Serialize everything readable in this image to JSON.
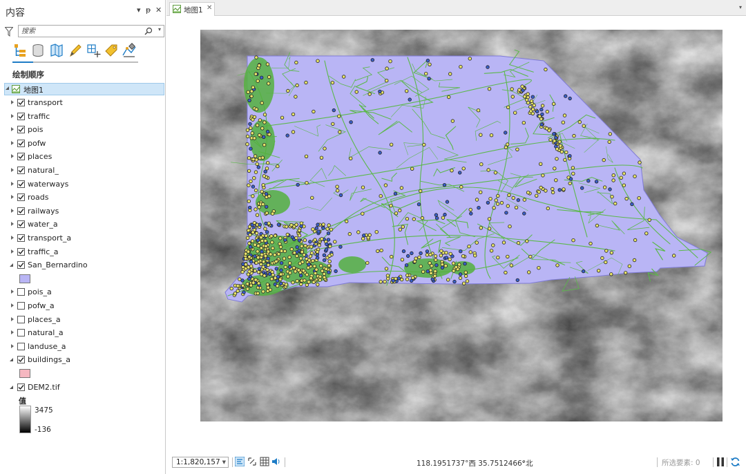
{
  "contents_pane": {
    "title": "内容",
    "pin_label": "▾ 🖈",
    "close_label": "✕",
    "search_placeholder": "搜索",
    "drawing_order_heading": "绘制顺序",
    "map_name": "地图1",
    "layers": [
      {
        "name": "transport",
        "checked": true,
        "expanded": false
      },
      {
        "name": "traffic",
        "checked": true,
        "expanded": false
      },
      {
        "name": "pois",
        "checked": true,
        "expanded": false
      },
      {
        "name": "pofw",
        "checked": true,
        "expanded": false
      },
      {
        "name": "places",
        "checked": true,
        "expanded": false
      },
      {
        "name": "natural_",
        "checked": true,
        "expanded": false
      },
      {
        "name": "waterways",
        "checked": true,
        "expanded": false
      },
      {
        "name": "roads",
        "checked": true,
        "expanded": false
      },
      {
        "name": "railways",
        "checked": true,
        "expanded": false
      },
      {
        "name": "water_a",
        "checked": true,
        "expanded": false
      },
      {
        "name": "transport_a",
        "checked": true,
        "expanded": false
      },
      {
        "name": "traffic_a",
        "checked": true,
        "expanded": false
      },
      {
        "name": "San_Bernardino",
        "checked": true,
        "expanded": true,
        "swatch_color": "#b9b5f5"
      },
      {
        "name": "pois_a",
        "checked": false,
        "expanded": false
      },
      {
        "name": "pofw_a",
        "checked": false,
        "expanded": false
      },
      {
        "name": "places_a",
        "checked": false,
        "expanded": false
      },
      {
        "name": "natural_a",
        "checked": false,
        "expanded": false
      },
      {
        "name": "landuse_a",
        "checked": false,
        "expanded": false
      },
      {
        "name": "buildings_a",
        "checked": true,
        "expanded": true,
        "swatch_color": "#f5b7c0"
      },
      {
        "name": "DEM2.tif",
        "checked": true,
        "expanded": true
      }
    ],
    "dem_legend": {
      "title": "值",
      "high": "3475",
      "low": "-136"
    }
  },
  "map_tab": {
    "label": "地图1",
    "close": "✕"
  },
  "status_bar": {
    "scale": "1:1,820,157",
    "coordinates": "118.1951737°西 35.7512466°北",
    "coordinates_dropdown": "⌄",
    "selected_features": "所选要素: 0"
  },
  "colors": {
    "accent": "#1d7cc6",
    "county_fill": "#b9b5f5",
    "roads": "#5bb84a",
    "poi_yellow": "#e6e36a",
    "poi_blue": "#3a5fc8",
    "selected_row": "#cfe6f8"
  },
  "icons": [
    "filter-icon",
    "search-icon",
    "list-by-drawing-order-icon",
    "list-by-data-source-icon",
    "list-by-selection-icon",
    "list-by-editing-icon",
    "list-by-snapping-icon",
    "list-by-labeling-icon",
    "list-by-perspective-icon",
    "map-icon",
    "fixed-zoom-icon",
    "grid-icon",
    "audio-icon",
    "pause-icon",
    "refresh-icon"
  ]
}
